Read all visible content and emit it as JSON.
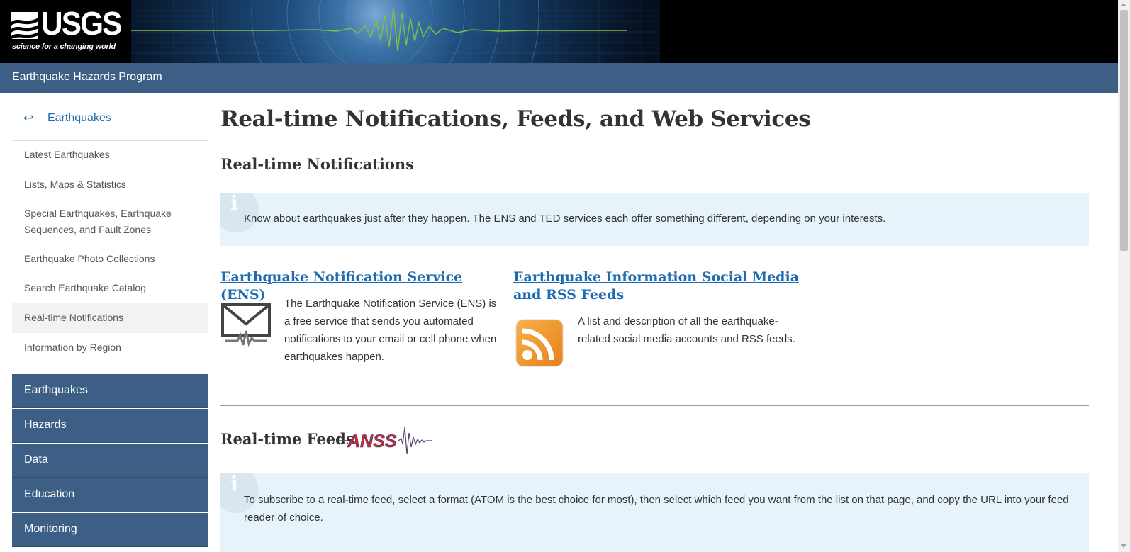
{
  "header": {
    "logo_text": "USGS",
    "logo_tagline": "science for a changing world",
    "program_title": "Earthquake Hazards Program"
  },
  "sidebar": {
    "back_arrow": "↩",
    "back_label": "Earthquakes",
    "items": [
      {
        "label": "Latest Earthquakes"
      },
      {
        "label": "Lists, Maps & Statistics"
      },
      {
        "label": "Special Earthquakes, Earthquake Sequences, and Fault Zones"
      },
      {
        "label": "Earthquake Photo Collections"
      },
      {
        "label": "Search Earthquake Catalog"
      },
      {
        "label": "Real-time Notifications",
        "active": true
      },
      {
        "label": "Information by Region"
      }
    ],
    "nav_sections": [
      {
        "label": "Earthquakes"
      },
      {
        "label": "Hazards"
      },
      {
        "label": "Data"
      },
      {
        "label": "Education"
      },
      {
        "label": "Monitoring"
      }
    ]
  },
  "main": {
    "page_title": "Real-time Notifications, Feeds, and Web Services",
    "notifications_heading": "Real-time Notifications",
    "notifications_callout": "Know about earthquakes just after they happen. The ENS and TED services each offer something different, depending on your interests.",
    "info_icon_glyph": "i",
    "cards": [
      {
        "title": "Earthquake Notification Service (ENS)",
        "text": "The Earthquake Notification Service (ENS) is a free service that sends you automated notifications to your email or cell phone when earthquakes happen.",
        "icon": "envelope-seismogram-icon"
      },
      {
        "title": "Earthquake Information Social Media and RSS Feeds",
        "text": "A list and description of all the earthquake-related social media accounts and RSS feeds.",
        "icon": "rss-icon"
      }
    ],
    "feeds_heading": "Real-time Feeds",
    "anss_logo_text": "ANSS",
    "feeds_callout": "To subscribe to a real-time feed, select a format (ATOM is the best choice for most), then select which feed you want from the list on that page, and copy the URL into your feed reader of choice."
  },
  "colors": {
    "program_bar": "#3d5f85",
    "link": "#1d6bb0",
    "callout_bg": "#e7f3fa",
    "rss_orange": "#f39a1d"
  }
}
